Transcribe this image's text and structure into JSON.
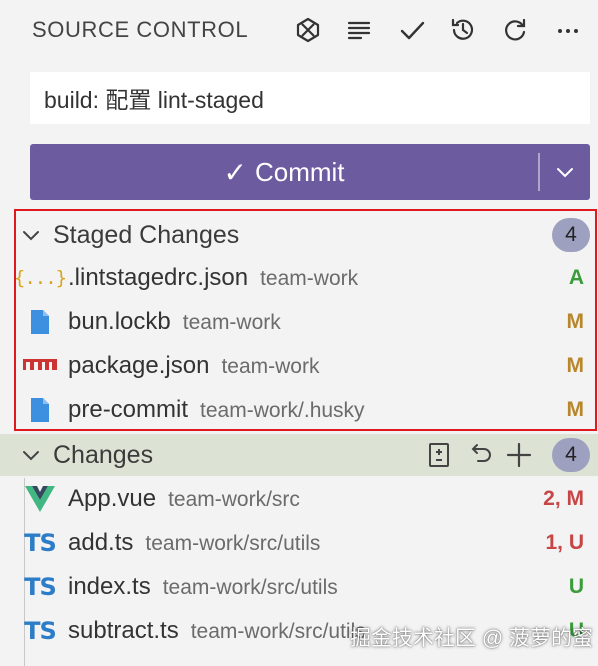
{
  "header": {
    "title": "SOURCE CONTROL",
    "icons": [
      "copilot-icon",
      "list-icon",
      "check-icon",
      "history-icon",
      "refresh-icon",
      "more-icon"
    ]
  },
  "commit_message": {
    "value": "build: 配置 lint-staged"
  },
  "commit_button": {
    "check_glyph": "✓",
    "label": "Commit"
  },
  "staged": {
    "title": "Staged Changes",
    "count": "4",
    "files": [
      {
        "name": ".lintstagedrc.json",
        "path": "team-work",
        "status": "A",
        "icon": "json-icon",
        "color": "#3a9c3a"
      },
      {
        "name": "bun.lockb",
        "path": "team-work",
        "status": "M",
        "icon": "file-icon",
        "color": "#b8862b"
      },
      {
        "name": "package.json",
        "path": "team-work",
        "status": "M",
        "icon": "npm-icon",
        "color": "#b8862b"
      },
      {
        "name": "pre-commit",
        "path": "team-work/.husky",
        "status": "M",
        "icon": "file-icon",
        "color": "#b8862b"
      }
    ]
  },
  "changes": {
    "title": "Changes",
    "count": "4",
    "files": [
      {
        "name": "App.vue",
        "path": "team-work/src",
        "status": "2, M",
        "icon": "vue-icon",
        "color": "#c74545"
      },
      {
        "name": "add.ts",
        "path": "team-work/src/utils",
        "status": "1, U",
        "icon": "ts-icon",
        "ts": "TS",
        "color": "#c74545"
      },
      {
        "name": "index.ts",
        "path": "team-work/src/utils",
        "status": "U",
        "icon": "ts-icon",
        "ts": "TS",
        "color": "#3a9c3a"
      },
      {
        "name": "subtract.ts",
        "path": "team-work/src/utils",
        "status": "U",
        "icon": "ts-icon",
        "ts": "TS",
        "color": "#3a9c3a"
      }
    ]
  },
  "json_icon_glyph": "{...}",
  "watermark": "掘金技术社区 @ 菠萝的蜜",
  "colors": {
    "commit_button": "#6c5b9f",
    "added": "#3a9c3a",
    "modified": "#b8862b",
    "conflict": "#c74545",
    "badge": "#9ea0c0",
    "highlight_border": "#e0191f"
  }
}
